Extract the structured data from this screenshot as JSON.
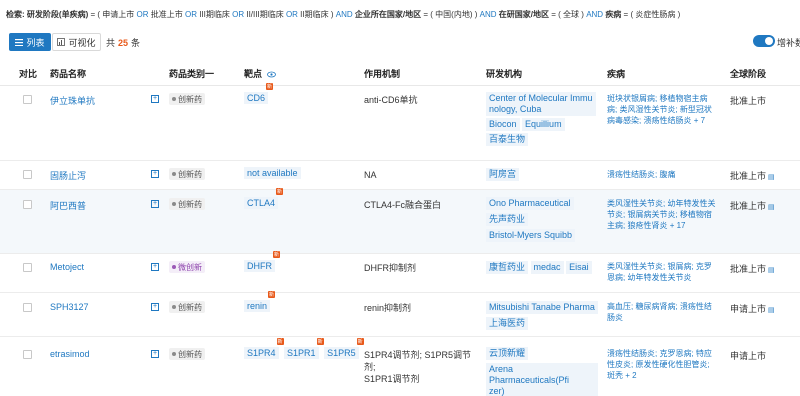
{
  "query": {
    "prefix": "检索:",
    "field1": "研发阶段(单疾病)",
    "eq": "=",
    "open": "(",
    "v1": "申请上市",
    "or": "OR",
    "v2": "批准上市",
    "v3": "III期临床",
    "v4": "II/III期临床",
    "v5": "II期临床",
    "close": ")",
    "and": "AND",
    "field2": "企业所在国家/地区",
    "v6": "中国(内地)",
    "field3": "在研国家/地区",
    "v7": "全球",
    "field4": "疾病",
    "v8": "炎症性肠病"
  },
  "toolbar": {
    "tab_list": "列表",
    "tab_visual": "可视化",
    "total_prefix": "共",
    "total_count": "25",
    "total_suffix": "条",
    "toggle_label": "增补数"
  },
  "columns": [
    "对比",
    "药品名称",
    "药品类别一",
    "靶点",
    "作用机制",
    "研发机构",
    "疾病",
    "全球阶段"
  ],
  "rows": [
    {
      "name": "伊立珠单抗",
      "category": "创新药",
      "targets": [
        "CD6"
      ],
      "mechanism": [
        "anti-CD6单抗"
      ],
      "orgs": [
        "Center of Molecular Immu",
        "nology, Cuba",
        "Biocon",
        "Equillium",
        "百泰生物"
      ],
      "diseases": [
        "斑块状银屑病; 移植物宿主病",
        "病; 类风湿性关节炎; 新型冠状",
        "病毒感染; 溃疡性结肠炎",
        "+ 7"
      ],
      "phase": "批准上市"
    },
    {
      "name": "固肠止泻",
      "category": "创新药",
      "targets": [
        "not available"
      ],
      "mechanism": [
        "NA"
      ],
      "orgs": [
        "阿房宫"
      ],
      "diseases": [
        "溃疡性结肠炎; 腹痛"
      ],
      "phase": "批准上市"
    },
    {
      "name": "阿巴西普",
      "category": "创新药",
      "targets": [
        "CTLA4"
      ],
      "mechanism": [
        "CTLA4-Fc融合蛋白"
      ],
      "orgs": [
        "Ono Pharmaceutical",
        "先声药业",
        "Bristol-Myers Squibb"
      ],
      "diseases": [
        "类风湿性关节炎; 幼年特发性关",
        "节炎; 银屑病关节炎; 移植物宿",
        "主病; 狼疮性肾炎",
        "+ 17"
      ],
      "phase": "批准上市"
    },
    {
      "name": "Metoject",
      "category": "微创新",
      "targets": [
        "DHFR"
      ],
      "mechanism": [
        "DHFR抑制剂"
      ],
      "orgs": [
        "康哲药业",
        "medac",
        "Eisai"
      ],
      "diseases": [
        "类风湿性关节炎; 银屑病; 克罗",
        "恩病; 幼年特发性关节炎"
      ],
      "phase": "批准上市"
    },
    {
      "name": "SPH3127",
      "category": "创新药",
      "targets": [
        "renin"
      ],
      "mechanism": [
        "renin抑制剂"
      ],
      "orgs": [
        "Mitsubishi Tanabe Pharma",
        "上海医药"
      ],
      "diseases": [
        "高血压; 糖尿病肾病; 溃疡性结",
        "肠炎"
      ],
      "phase": "申请上市"
    },
    {
      "name": "etrasimod",
      "category": "创新药",
      "targets": [
        "S1PR4",
        "S1PR1",
        "S1PR5"
      ],
      "mechanism": [
        "S1PR4调节剂; S1PR5调节剂;",
        "S1PR1调节剂"
      ],
      "orgs": [
        "云顶新耀",
        "Arena Pharmaceuticals(Pfi",
        "zer)"
      ],
      "diseases": [
        "溃疡性结肠炎; 克罗恩病; 特应",
        "性皮炎; 原发性硬化性胆管炎;",
        "斑秃",
        "+ 2"
      ],
      "phase": "申请上市"
    }
  ],
  "badge_text": "新",
  "colors": {
    "accent": "#1f78c1",
    "count": "#e8591a"
  }
}
